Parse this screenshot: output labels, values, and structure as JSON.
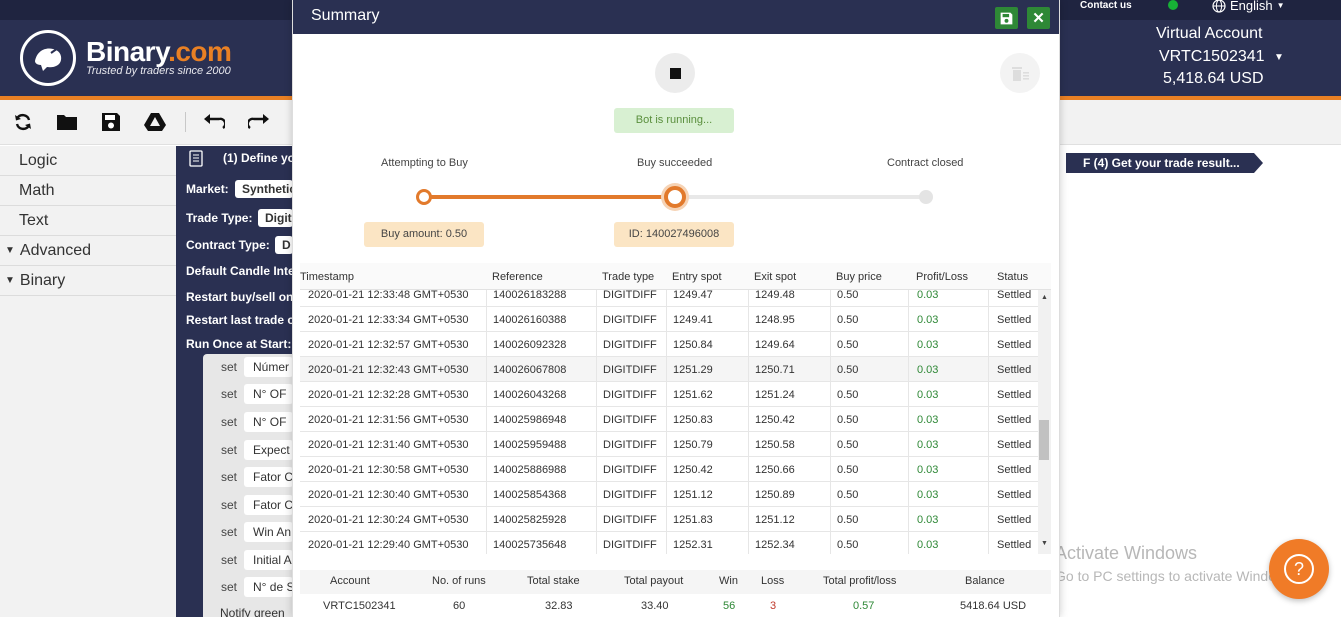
{
  "header": {
    "brand_name": "Binary",
    "brand_suffix": ".com",
    "tagline": "Trusted by traders since 2000",
    "contact": "Contact us",
    "language": "English",
    "account_title": "Virtual Account",
    "account_id": "VRTC1502341",
    "account_balance": "5,418.64 USD",
    "status_color": "#17b036",
    "accent_color": "#e98024"
  },
  "toolbar": {
    "icons": [
      "reload-icon",
      "folder-icon",
      "save-icon",
      "google-drive-icon",
      "undo-icon",
      "redo-icon"
    ]
  },
  "sidebar": {
    "items": [
      {
        "label": "Logic"
      },
      {
        "label": "Math"
      },
      {
        "label": "Text"
      },
      {
        "label": "Advanced"
      },
      {
        "label": "Binary"
      }
    ]
  },
  "block": {
    "title": "(1) Define yo",
    "rows": [
      {
        "label": "Market:",
        "value": "Synthetic"
      },
      {
        "label": "Trade Type:",
        "value": "Digit"
      },
      {
        "label": "Contract Type:",
        "value": "D"
      },
      {
        "label": "Default Candle Inte",
        "value": ""
      },
      {
        "label": "Restart buy/sell on",
        "value": ""
      },
      {
        "label": "Restart last trade o",
        "value": ""
      },
      {
        "label": "Run Once at Start:",
        "value": ""
      }
    ],
    "set_keyword": "set",
    "set_vars": [
      "Númer",
      "N° OF",
      "N° OF",
      "Expect",
      "Fator C",
      "Fator C",
      "Win An",
      "Initial A",
      "N° de S"
    ],
    "notify": "Notify green"
  },
  "ribbon": "F (4) Get your trade result...",
  "watermark": {
    "line1": "Activate Windows",
    "line2": "Go to PC settings to activate Windows."
  },
  "summary": {
    "title": "Summary",
    "status": "Bot is running...",
    "steps": [
      "Attempting to Buy",
      "Buy succeeded",
      "Contract closed"
    ],
    "buy_amount": "Buy amount: 0.50",
    "contract_id": "ID: 140027496008",
    "progress_step": 2,
    "columns": [
      "Timestamp",
      "Reference",
      "Trade type",
      "Entry spot",
      "Exit spot",
      "Buy price",
      "Profit/Loss",
      "Status"
    ],
    "trades": [
      [
        "2020-01-21 12:33:48 GMT+0530",
        "140026183288",
        "DIGITDIFF",
        "1249.47",
        "1249.48",
        "0.50",
        "0.03",
        "Settled"
      ],
      [
        "2020-01-21 12:33:34 GMT+0530",
        "140026160388",
        "DIGITDIFF",
        "1249.41",
        "1248.95",
        "0.50",
        "0.03",
        "Settled"
      ],
      [
        "2020-01-21 12:32:57 GMT+0530",
        "140026092328",
        "DIGITDIFF",
        "1250.84",
        "1249.64",
        "0.50",
        "0.03",
        "Settled"
      ],
      [
        "2020-01-21 12:32:43 GMT+0530",
        "140026067808",
        "DIGITDIFF",
        "1251.29",
        "1250.71",
        "0.50",
        "0.03",
        "Settled"
      ],
      [
        "2020-01-21 12:32:28 GMT+0530",
        "140026043268",
        "DIGITDIFF",
        "1251.62",
        "1251.24",
        "0.50",
        "0.03",
        "Settled"
      ],
      [
        "2020-01-21 12:31:56 GMT+0530",
        "140025986948",
        "DIGITDIFF",
        "1250.83",
        "1250.42",
        "0.50",
        "0.03",
        "Settled"
      ],
      [
        "2020-01-21 12:31:40 GMT+0530",
        "140025959488",
        "DIGITDIFF",
        "1250.79",
        "1250.58",
        "0.50",
        "0.03",
        "Settled"
      ],
      [
        "2020-01-21 12:30:58 GMT+0530",
        "140025886988",
        "DIGITDIFF",
        "1250.42",
        "1250.66",
        "0.50",
        "0.03",
        "Settled"
      ],
      [
        "2020-01-21 12:30:40 GMT+0530",
        "140025854368",
        "DIGITDIFF",
        "1251.12",
        "1250.89",
        "0.50",
        "0.03",
        "Settled"
      ],
      [
        "2020-01-21 12:30:24 GMT+0530",
        "140025825928",
        "DIGITDIFF",
        "1251.83",
        "1251.12",
        "0.50",
        "0.03",
        "Settled"
      ],
      [
        "2020-01-21 12:29:40 GMT+0530",
        "140025735648",
        "DIGITDIFF",
        "1252.31",
        "1252.34",
        "0.50",
        "0.03",
        "Settled"
      ]
    ],
    "totals_columns": [
      "Account",
      "No. of runs",
      "Total stake",
      "Total payout",
      "Win",
      "Loss",
      "Total profit/loss",
      "Balance"
    ],
    "totals": [
      "VRTC1502341",
      "60",
      "32.83",
      "33.40",
      "56",
      "3",
      "0.57",
      "5418.64 USD"
    ],
    "win_color": "#2e8836",
    "loss_color": "#c0392b"
  }
}
